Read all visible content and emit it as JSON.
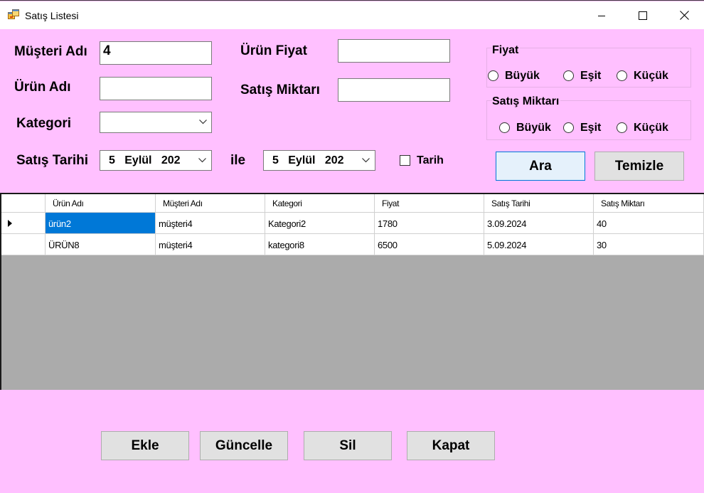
{
  "window": {
    "title": "Satış Listesi"
  },
  "filters": {
    "musteri_adi_label": "Müşteri Adı",
    "musteri_adi_value": "4",
    "urun_adi_label": "Ürün Adı",
    "urun_adi_value": "",
    "kategori_label": "Kategori",
    "kategori_value": "",
    "urun_fiyat_label": "Ürün Fiyat",
    "urun_fiyat_value": "",
    "satis_miktari_label": "Satış Miktarı",
    "satis_miktari_value": "",
    "satis_tarihi_label": "Satış Tarihi",
    "date_from": {
      "day": "5",
      "month": "Eylül",
      "year": "202"
    },
    "ile_label": "ile",
    "date_to": {
      "day": "5",
      "month": "Eylül",
      "year": "202"
    },
    "tarih_checkbox_label": "Tarih",
    "tarih_checked": false
  },
  "fiyat_group": {
    "title": "Fiyat",
    "options": [
      "Büyük",
      "Eşit",
      "Küçük"
    ]
  },
  "miktar_group": {
    "title": "Satış Miktarı",
    "options": [
      "Büyük",
      "Eşit",
      "Küçük"
    ]
  },
  "actions": {
    "ara": "Ara",
    "temizle": "Temizle"
  },
  "grid": {
    "columns": [
      "Ürün Adı",
      "Müşteri Adı",
      "Kategori",
      "Fiyat",
      "Satış Tarihi",
      "Satış Miktarı"
    ],
    "rows": [
      [
        "ürün2",
        "müşteri4",
        "Kategori2",
        "1780",
        "3.09.2024",
        "40"
      ],
      [
        "ÜRÜN8",
        "müşteri4",
        "kategori8",
        "6500",
        "5.09.2024",
        "30"
      ]
    ]
  },
  "bottom_buttons": {
    "ekle": "Ekle",
    "guncelle": "Güncelle",
    "sil": "Sil",
    "kapat": "Kapat"
  },
  "colors": {
    "form_bg": "#ffc0ff",
    "grid_bg": "#ababab",
    "selection": "#0078d7"
  },
  "icons": {
    "app": "form-app-icon",
    "minimize": "minimize-icon",
    "maximize": "maximize-icon",
    "close": "close-icon",
    "row_pointer": "row-pointer-icon",
    "dropdown": "chevron-down-icon"
  }
}
